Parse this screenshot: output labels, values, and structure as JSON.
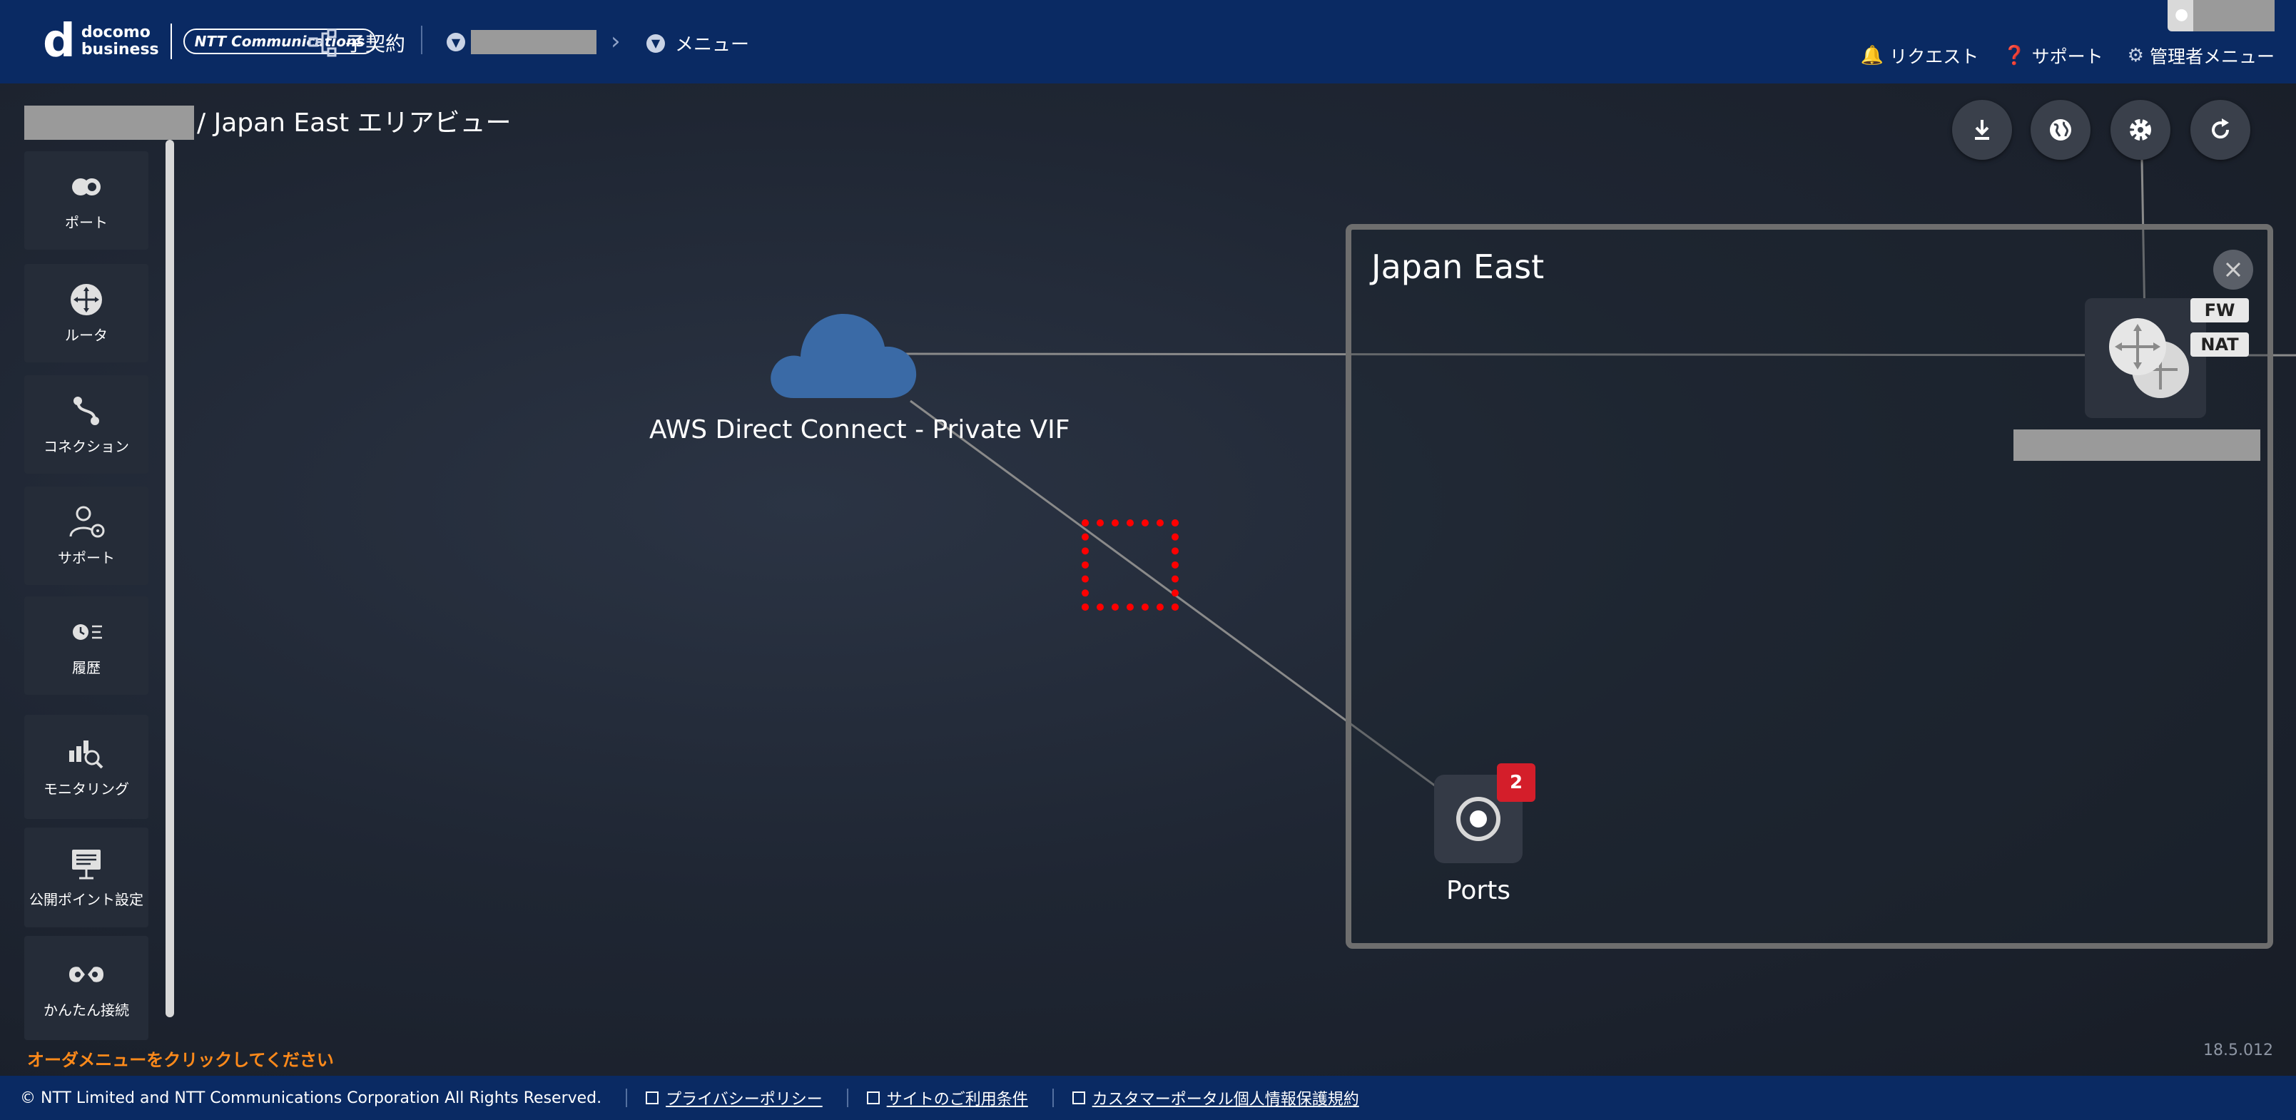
{
  "header": {
    "logo_mark": "d",
    "logo_line1": "docomo",
    "logo_line2": "business",
    "ntt_logo": "NTT Communications",
    "sub_contract_label": "子契約",
    "menu_label": "メニュー",
    "links": [
      {
        "label": "リクエスト",
        "icon": "bell-icon"
      },
      {
        "label": "サポート",
        "icon": "help-icon"
      },
      {
        "label": "管理者メニュー",
        "icon": "gear-icon"
      }
    ]
  },
  "page": {
    "title": "/ Japan East エリアビュー"
  },
  "sidebar": {
    "items": [
      {
        "label": "ポート",
        "icon": "port-icon"
      },
      {
        "label": "ルータ",
        "icon": "router-icon"
      },
      {
        "label": "コネクション",
        "icon": "connection-icon"
      },
      {
        "label": "サポート",
        "icon": "support-icon"
      },
      {
        "label": "履歴",
        "icon": "history-icon"
      },
      {
        "label": "モニタリング",
        "icon": "monitoring-icon"
      },
      {
        "label": "公開ポイント設定",
        "icon": "public-point-icon"
      },
      {
        "label": "かんたん接続",
        "icon": "easy-connect-icon"
      }
    ],
    "order_hint": "オーダメニューをクリックしてください"
  },
  "toolbar": {
    "buttons": [
      {
        "icon": "download-icon"
      },
      {
        "icon": "globe-icon"
      },
      {
        "icon": "settings-icon"
      },
      {
        "icon": "refresh-icon"
      }
    ]
  },
  "canvas": {
    "aws_label": "AWS Direct Connect - Private VIF",
    "region_title": "Japan East",
    "ports_label": "Ports",
    "ports_badge": "2",
    "router_tags": [
      "FW",
      "NAT"
    ]
  },
  "version": "18.5.012",
  "footer": {
    "copyright": "© NTT Limited and NTT Communications Corporation All Rights Reserved.",
    "links": [
      "プライバシーポリシー",
      "サイトのご利用条件",
      "カスタマーポータル個人情報保護規約"
    ]
  },
  "colors": {
    "header_bg": "#0a2a63",
    "accent_orange": "#ff8a1a",
    "badge_red": "#d41e2a",
    "selection_red": "#ff0000",
    "aws_cloud": "#3a6aa6"
  }
}
